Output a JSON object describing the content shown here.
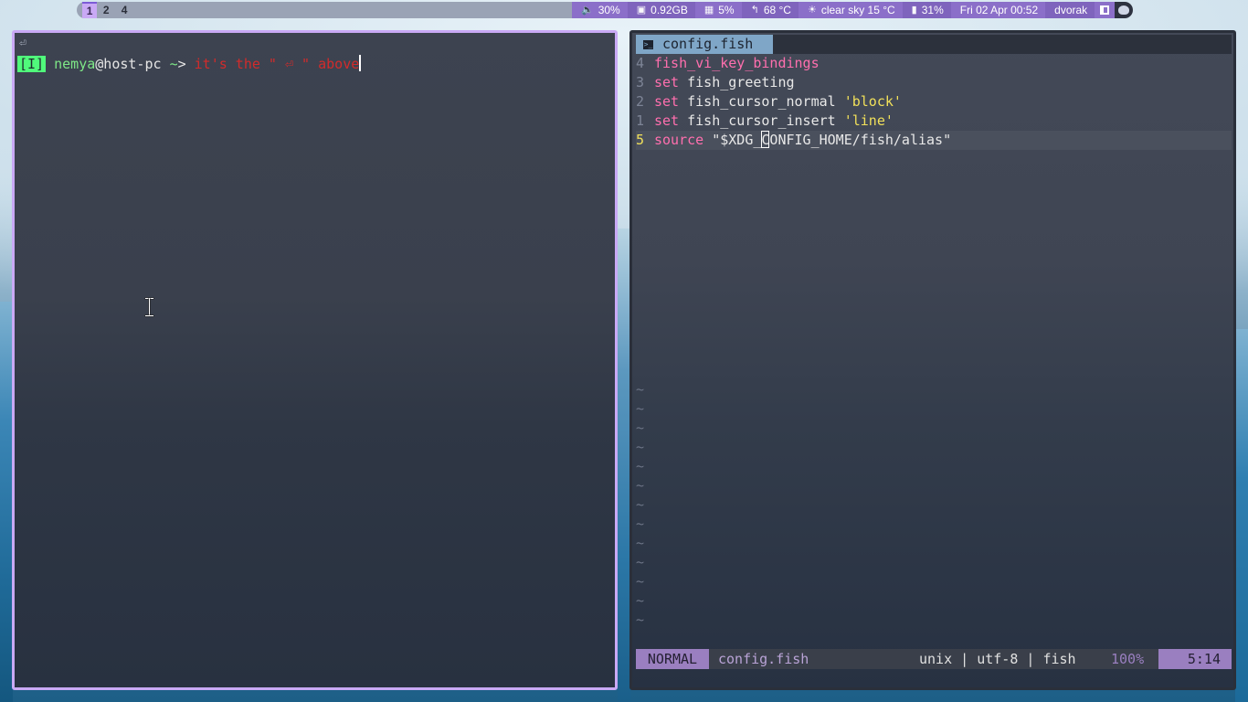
{
  "topbar": {
    "workspaces": [
      "1",
      "2",
      "4"
    ],
    "volume": "30%",
    "memory": "0.92GB",
    "cpu": "5%",
    "temperature": "68 °C",
    "weather": "clear sky 15 °C",
    "battery": "31%",
    "datetime": "Fri 02 Apr 00:52",
    "keyboard_layout": "dvorak"
  },
  "terminal": {
    "return_glyph": "⏎",
    "mode_badge": "[I]",
    "user": "nemya",
    "at_host": "@host-pc",
    "path": "~",
    "arrow": ">",
    "command": "it's the \" ⏎ \" above"
  },
  "vim": {
    "tab_title": "config.fish",
    "lines": [
      {
        "num": "4",
        "parts": [
          {
            "t": "fish_vi_key_bindings",
            "c": "k-fn"
          }
        ]
      },
      {
        "num": "3",
        "parts": [
          {
            "t": "set ",
            "c": "k-set"
          },
          {
            "t": "fish_greeting",
            "c": "k-id"
          }
        ]
      },
      {
        "num": "2",
        "parts": [
          {
            "t": "set ",
            "c": "k-set"
          },
          {
            "t": "fish_cursor_normal ",
            "c": "k-id"
          },
          {
            "t": "'block'",
            "c": "k-str"
          }
        ]
      },
      {
        "num": "1",
        "parts": [
          {
            "t": "set ",
            "c": "k-set"
          },
          {
            "t": "fish_cursor_insert ",
            "c": "k-id"
          },
          {
            "t": "'line'",
            "c": "k-str"
          }
        ]
      },
      {
        "num": "5",
        "current": true,
        "parts": [
          {
            "t": "source ",
            "c": "k-src"
          },
          {
            "t": "\"$XDG_",
            "c": "k-var"
          },
          {
            "t": "CURSOR"
          },
          {
            "t": "CONFIG_HOME/fish/alias\"",
            "c": "k-var"
          }
        ]
      }
    ],
    "tilde_count": 13,
    "tilde_char": "~",
    "status": {
      "mode": "NORMAL",
      "file": "config.fish",
      "info": "unix | utf-8 | fish",
      "percent": "100%",
      "position": "5:14"
    }
  }
}
